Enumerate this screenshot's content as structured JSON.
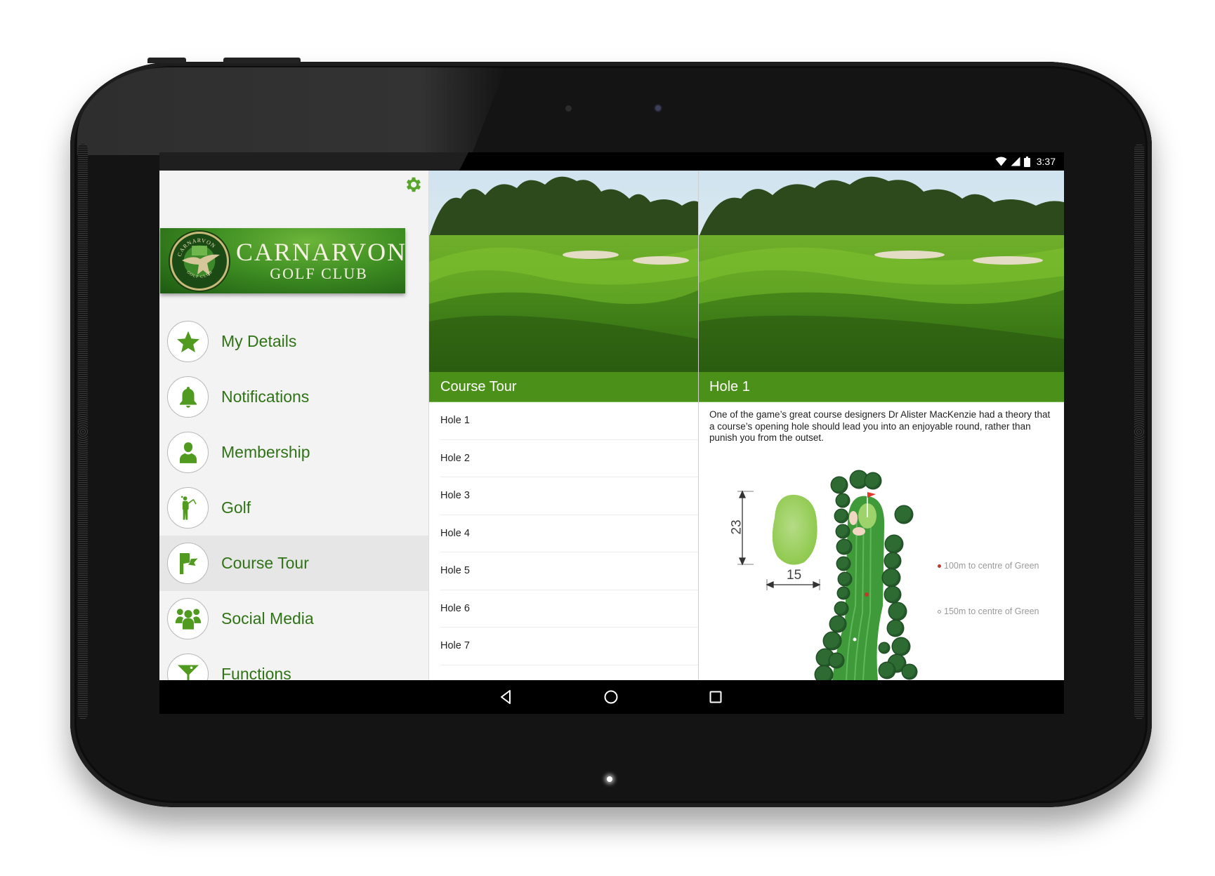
{
  "status_bar": {
    "time": "3:37",
    "icons": [
      "wifi-icon",
      "cell-signal-icon",
      "battery-icon"
    ]
  },
  "sidebar": {
    "settings_icon": "gear-icon",
    "logo": {
      "title": "CARNARVON",
      "subtitle": "GOLF CLUB",
      "crest_top_text": "CARNARVON",
      "crest_bottom_text": "GOLF CLUB"
    },
    "items": [
      {
        "label": "My Details",
        "icon": "star-icon",
        "active": false
      },
      {
        "label": "Notifications",
        "icon": "bell-icon",
        "active": false
      },
      {
        "label": "Membership",
        "icon": "person-icon",
        "active": false
      },
      {
        "label": "Golf",
        "icon": "golfer-icon",
        "active": false
      },
      {
        "label": "Course Tour",
        "icon": "flag-icon",
        "active": true
      },
      {
        "label": "Social Media",
        "icon": "group-icon",
        "active": false
      },
      {
        "label": "Functions",
        "icon": "cocktail-icon",
        "active": false
      }
    ]
  },
  "course_tour": {
    "header": "Course Tour",
    "holes": [
      "Hole 1",
      "Hole 2",
      "Hole 3",
      "Hole 4",
      "Hole 5",
      "Hole 6",
      "Hole 7"
    ]
  },
  "hole_detail": {
    "header": "Hole 1",
    "description": "One of the game’s great course designers Dr Alister MacKenzie had a theory that a course’s opening hole should lead you into an enjoyable round, rather than punish you from the outset.",
    "green_depth": "23",
    "green_width": "15",
    "legend": [
      {
        "label": "100m to centre of Green",
        "marker": "red-dot"
      },
      {
        "label": "150m to centre of Green",
        "marker": "white-dot"
      }
    ]
  },
  "nav_bar": {
    "buttons": [
      "back-button",
      "home-button",
      "recents-button"
    ]
  },
  "colors": {
    "brand_green": "#4b9119",
    "menu_text_green": "#2f7316",
    "icon_green": "#4f9a1f",
    "gear_green": "#5aa62a",
    "active_row": "#e6e6e6"
  }
}
